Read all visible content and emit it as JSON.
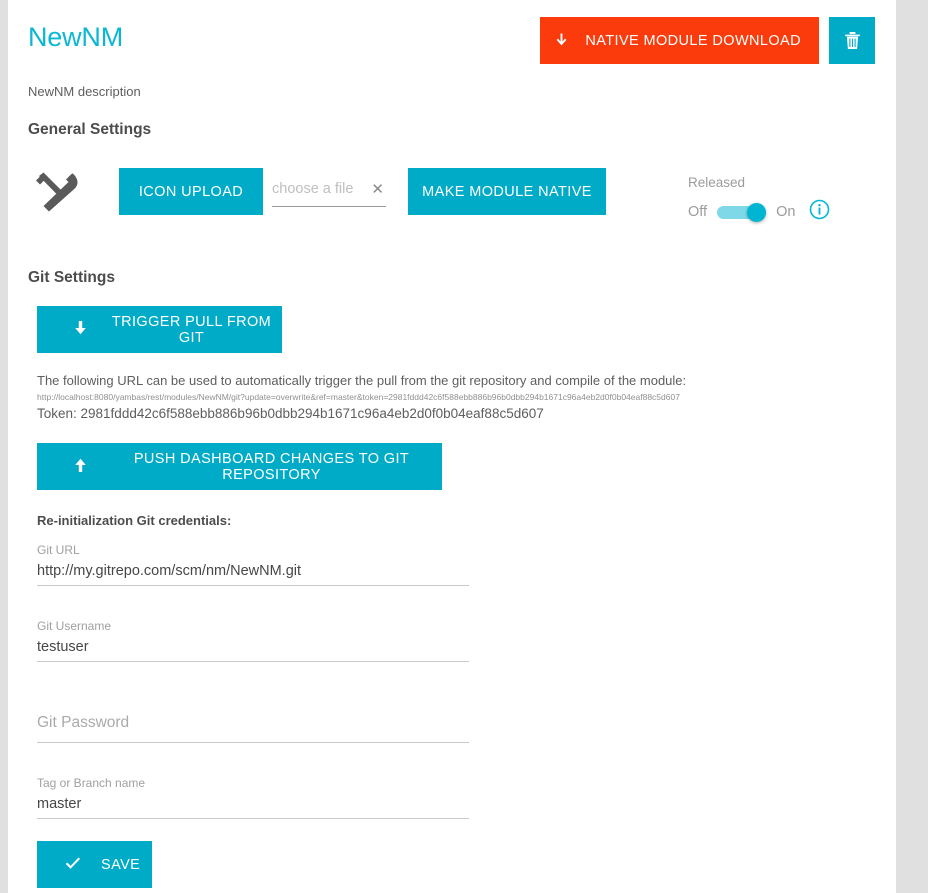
{
  "header": {
    "title": "NewNM",
    "download_button": "NATIVE MODULE DOWNLOAD",
    "download_icon": "arrow-down-icon",
    "delete_icon": "trash-icon",
    "download_color": "#fb3b0c",
    "accent_color": "#00abc7",
    "title_color": "#0bb8d4"
  },
  "description": "NewNM description",
  "general": {
    "section_title": "General Settings",
    "tools_icon": "tools-icon",
    "icon_upload_button": "ICON UPLOAD",
    "file_placeholder": "choose a file",
    "file_clear_icon": "close-icon",
    "make_native_button": "MAKE MODULE NATIVE",
    "released_label": "Released",
    "toggle_off_label": "Off",
    "toggle_on_label": "On",
    "toggle_state": "On",
    "info_icon": "info-icon"
  },
  "git": {
    "section_title": "Git Settings",
    "pull_button": "TRIGGER PULL FROM GIT",
    "pull_icon": "arrow-down-icon",
    "url_note": "The following URL can be used to automatically trigger the pull from the git repository and compile of the module:",
    "trigger_url": "http://localhost:8080/yambas/rest/modules/NewNM/git?update=overwrite&ref=master&token=2981fddd42c6f588ebb886b96b0dbb294b1671c96a4eb2d0f0b04eaf88c5d607",
    "token_line": "Token: 2981fddd42c6f588ebb886b96b0dbb294b1671c96a4eb2d0f0b04eaf88c5d607",
    "push_button": "PUSH DASHBOARD CHANGES TO GIT REPOSITORY",
    "push_icon": "arrow-up-icon",
    "reinit_title": "Re-initialization Git credentials:",
    "fields": {
      "git_url": {
        "label": "Git URL",
        "value": "http://my.gitrepo.com/scm/nm/NewNM.git"
      },
      "git_username": {
        "label": "Git Username",
        "value": "testuser"
      },
      "git_password": {
        "label": "Git Password",
        "value": ""
      },
      "tag_or_branch": {
        "label": "Tag or Branch name",
        "value": "master"
      }
    },
    "save_button": "SAVE",
    "save_icon": "check-icon"
  }
}
